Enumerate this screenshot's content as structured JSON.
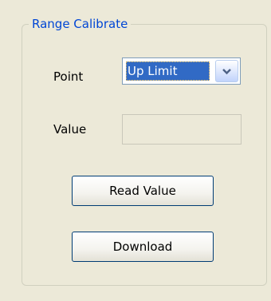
{
  "group": {
    "title": "Range Calibrate"
  },
  "fields": {
    "point_label": "Point",
    "point_value": "Up Limit",
    "value_label": "Value",
    "value_value": ""
  },
  "buttons": {
    "read_value": "Read Value",
    "download": "Download"
  },
  "icons": {
    "combo_arrow": "chevron-down-icon"
  },
  "colors": {
    "title": "#0046d5",
    "selection": "#316ac5",
    "background": "#ece9d8"
  }
}
